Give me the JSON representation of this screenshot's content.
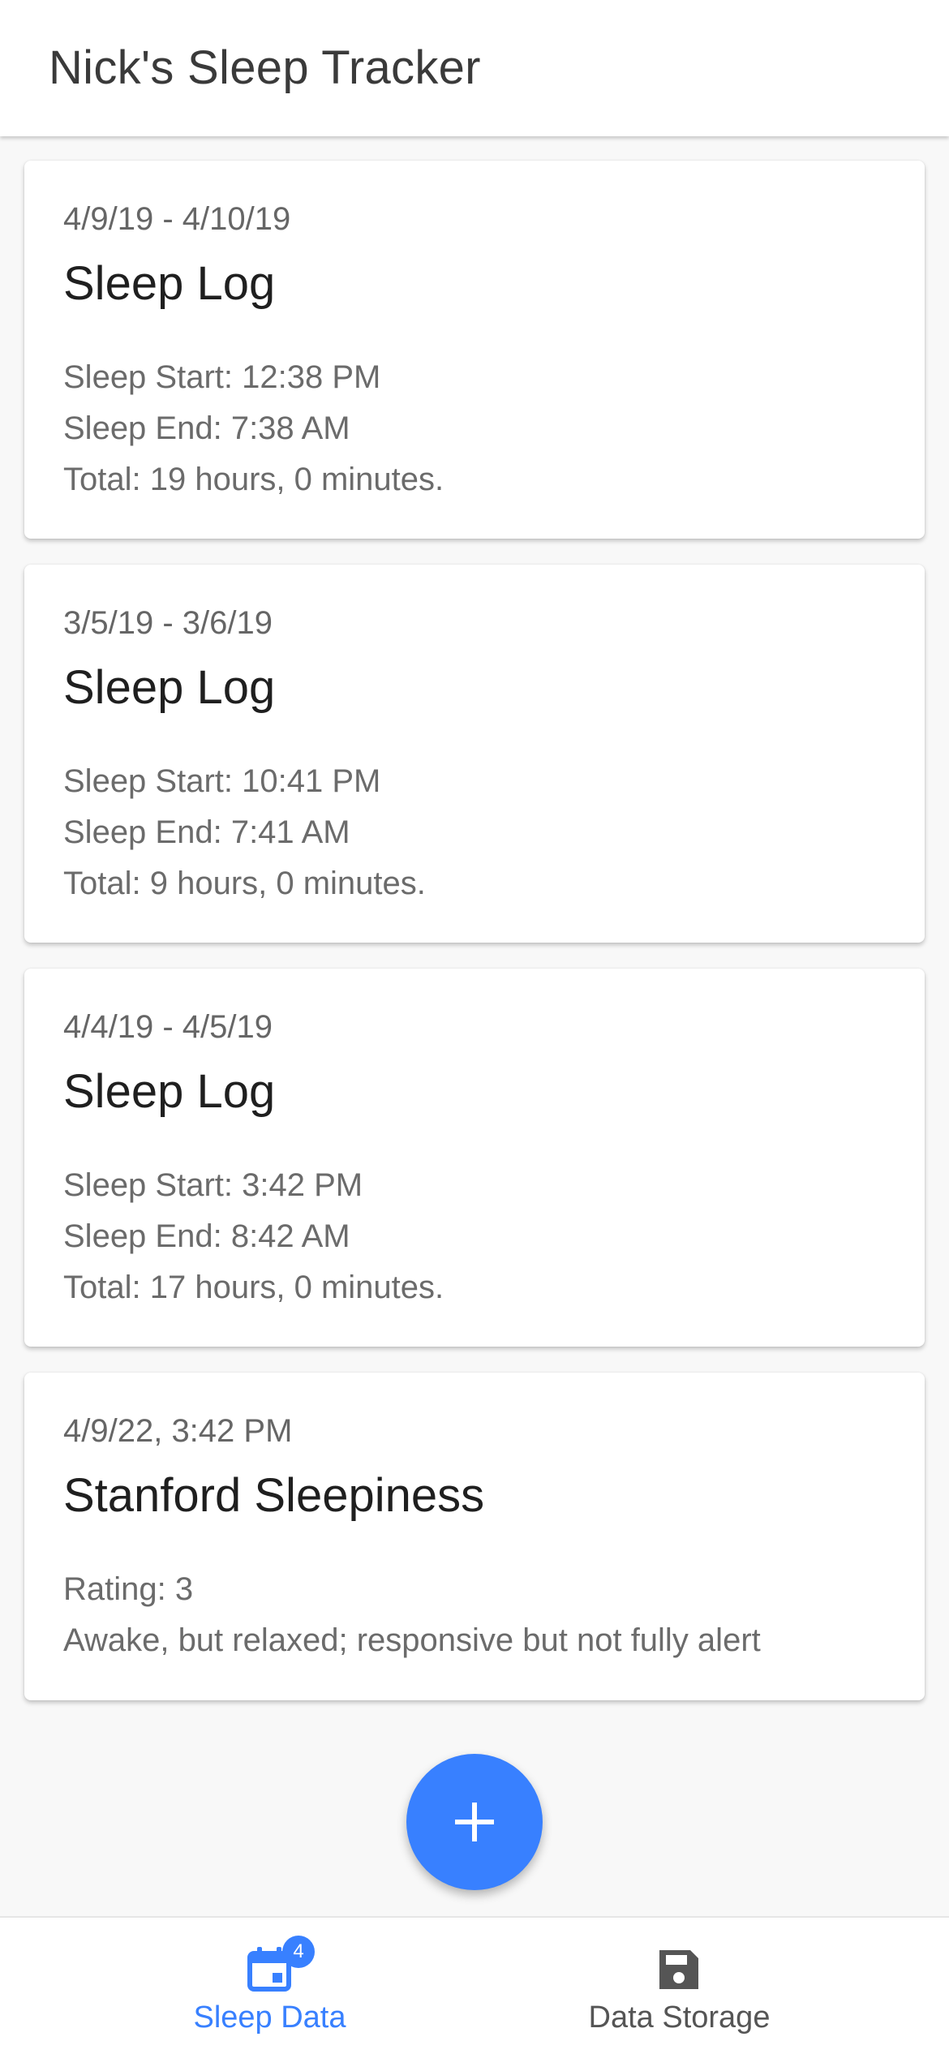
{
  "header": {
    "title": "Nick's Sleep Tracker"
  },
  "cards": [
    {
      "subtitle": "4/9/19 - 4/10/19",
      "title": "Sleep Log",
      "lines": [
        "Sleep Start: 12:38 PM",
        "Sleep End: 7:38 AM",
        "Total: 19 hours, 0 minutes."
      ]
    },
    {
      "subtitle": "3/5/19 - 3/6/19",
      "title": "Sleep Log",
      "lines": [
        "Sleep Start: 10:41 PM",
        "Sleep End: 7:41 AM",
        "Total: 9 hours, 0 minutes."
      ]
    },
    {
      "subtitle": "4/4/19 - 4/5/19",
      "title": "Sleep Log",
      "lines": [
        "Sleep Start: 3:42 PM",
        "Sleep End: 8:42 AM",
        "Total: 17 hours, 0 minutes."
      ]
    },
    {
      "subtitle": "4/9/22, 3:42 PM",
      "title": "Stanford Sleepiness",
      "lines": [
        "Rating: 3",
        "Awake, but relaxed; responsive but not fully alert"
      ]
    }
  ],
  "fab": {
    "icon": "plus-icon"
  },
  "tabs": [
    {
      "label": "Sleep Data",
      "icon": "calendar-icon",
      "badge": "4",
      "selected": true
    },
    {
      "label": "Data Storage",
      "icon": "save-icon",
      "selected": false
    }
  ],
  "colors": {
    "accent": "#3880ff",
    "inactive_tab": "#555555",
    "card_text": "#6b6b6b"
  }
}
